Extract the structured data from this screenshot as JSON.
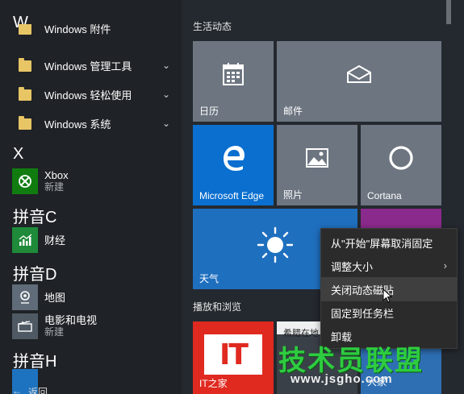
{
  "app_list": {
    "letters": {
      "w": "W",
      "x": "X",
      "c": "拼音C",
      "d": "拼音D",
      "h": "拼音H"
    },
    "apps": [
      {
        "name": "Windows 附件",
        "sub": "",
        "chevron": "⌄"
      },
      {
        "name": "Windows 管理工具",
        "sub": "",
        "chevron": "⌄"
      },
      {
        "name": "Windows 轻松使用",
        "sub": "",
        "chevron": "⌄"
      },
      {
        "name": "Windows 系统",
        "sub": "",
        "chevron": "⌄"
      },
      {
        "name": "Xbox",
        "sub": "新建"
      },
      {
        "name": "财经",
        "sub": ""
      },
      {
        "name": "地图",
        "sub": ""
      },
      {
        "name": "电影和电视",
        "sub": "新建"
      }
    ],
    "back_label": "返回"
  },
  "tiles": {
    "group1_title": "生活动态",
    "group2_title": "播放和浏览",
    "calendar": "日历",
    "mail": "邮件",
    "edge": "Microsoft Edge",
    "photos": "照片",
    "cortana": "Cortana",
    "weather": "天气",
    "news": "IT之家",
    "music_text": "希腊在地",
    "store_text": "大家"
  },
  "context_menu": {
    "items": [
      {
        "label": "从\"开始\"屏幕取消固定"
      },
      {
        "label": "调整大小",
        "arrow": "›"
      },
      {
        "label": "关闭动态磁贴"
      },
      {
        "label": "固定到任务栏"
      },
      {
        "label": "卸载"
      }
    ]
  },
  "watermark": {
    "title": "技术员联盟",
    "url": "www.jsgho.com"
  },
  "colors": {
    "accent": "#1e73c0",
    "tile_gray": "#6c7580",
    "edge_blue": "#0a6fcf",
    "weather_blue": "#1f6fbf",
    "purple": "#8a2a8c",
    "red": "#e02a20",
    "xbox_green": "#107c10",
    "finance_green": "#1e8a3a",
    "folder": "#e8c565"
  }
}
